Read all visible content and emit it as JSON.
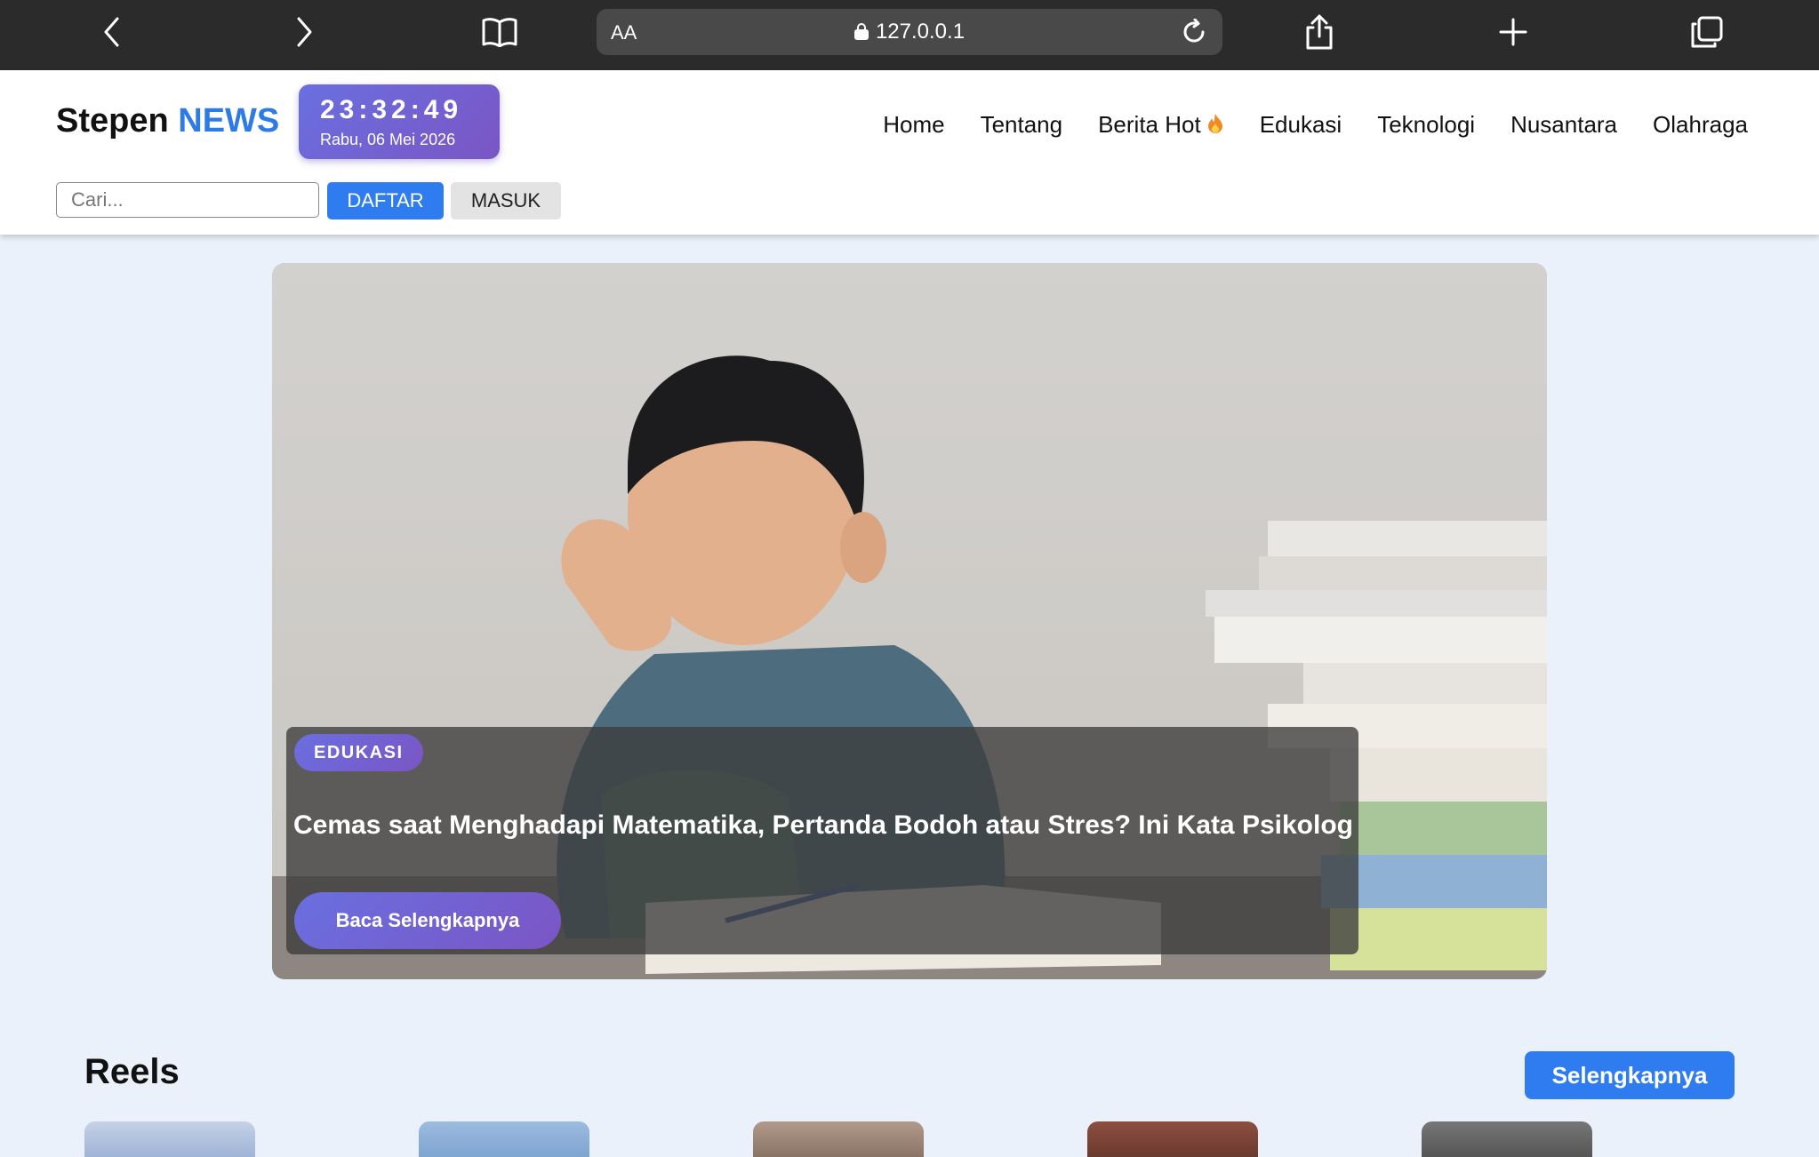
{
  "browser": {
    "url_size_label": "AA",
    "url": "127.0.0.1"
  },
  "header": {
    "logo_main": "Stepen",
    "logo_accent": "NEWS",
    "clock_time": "23:32:49",
    "clock_date": "Rabu, 06 Mei 2026",
    "nav": [
      "Home",
      "Tentang",
      "Berita Hot",
      "Edukasi",
      "Teknologi",
      "Nusantara",
      "Olahraga"
    ],
    "search_placeholder": "Cari...",
    "register_label": "DAFTAR",
    "login_label": "MASUK"
  },
  "hero": {
    "category": "EDUKASI",
    "title": "Cemas saat Menghadapi Matematika, Pertanda Bodoh atau Stres? Ini Kata Psikolog",
    "cta": "Baca Selengkapnya"
  },
  "reels": {
    "title": "Reels",
    "more_label": "Selengkapnya",
    "thumb_colors": [
      "#9fb3d6",
      "#7ea4d0",
      "#8a7466",
      "#6b3a2e",
      "#555555"
    ]
  },
  "colors": {
    "accent_blue": "#2e7cf0",
    "accent_purple": "#7b55c4"
  }
}
